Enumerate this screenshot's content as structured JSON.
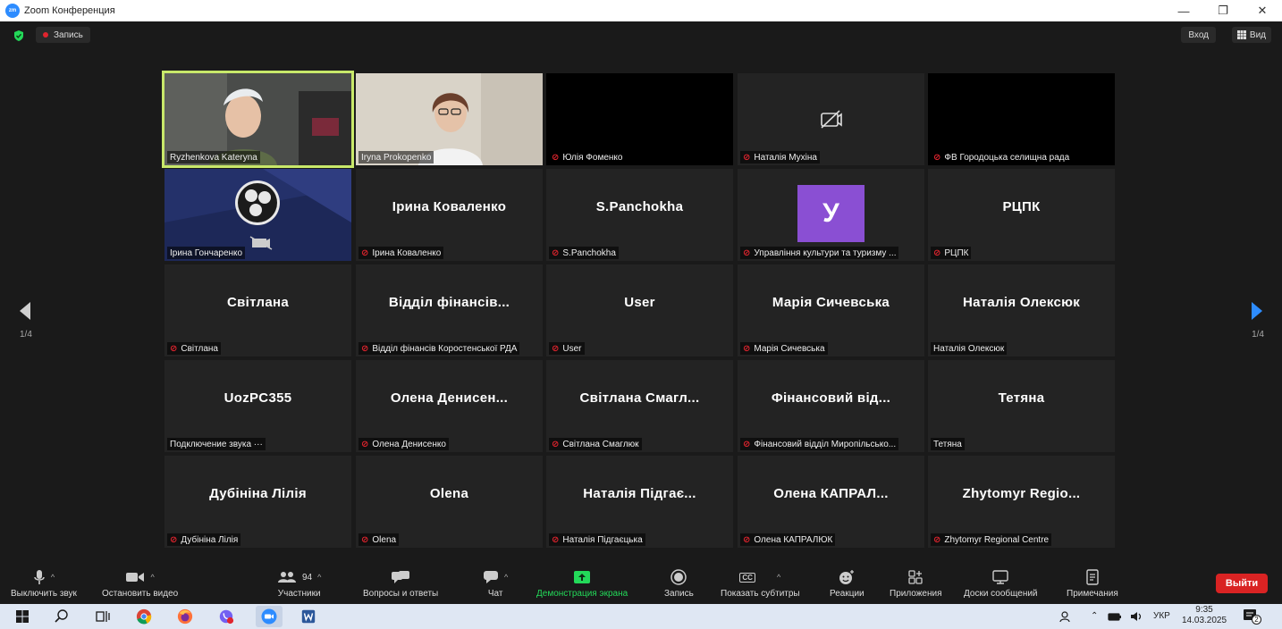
{
  "window": {
    "title": "Zoom Конференция",
    "min": "—",
    "max": "❐",
    "close": "✕"
  },
  "topbar": {
    "record_label": "Запись",
    "login_label": "Вход",
    "view_label": "Вид"
  },
  "pagination": {
    "left": "1/4",
    "right": "1/4"
  },
  "tiles": [
    {
      "name": "Ryzhenkova Kateryna",
      "big": "",
      "muted": false,
      "video": "person1"
    },
    {
      "name": "Iryna Prokopenko",
      "big": "",
      "muted": false,
      "video": "person2"
    },
    {
      "name": "Юлія Фоменко",
      "big": "",
      "muted": true,
      "video": "black"
    },
    {
      "name": "Наталія Мухіна",
      "big": "",
      "muted": true,
      "video": "cam-off"
    },
    {
      "name": "ФВ Городоцька селищна рада",
      "big": "",
      "muted": true,
      "video": "black"
    },
    {
      "name": "Ірина Гончаренко",
      "big": "",
      "muted": false,
      "video": "obs"
    },
    {
      "name": "Ірина Коваленко",
      "big": "Ірина Коваленко",
      "muted": true,
      "video": ""
    },
    {
      "name": "S.Panchokha",
      "big": "S.Panchokha",
      "muted": true,
      "video": ""
    },
    {
      "name": "Управління культури та туризму ...",
      "big": "У",
      "muted": true,
      "video": "avatar"
    },
    {
      "name": "РЦПК",
      "big": "РЦПК",
      "muted": true,
      "video": ""
    },
    {
      "name": "Світлана",
      "big": "Світлана",
      "muted": true,
      "video": ""
    },
    {
      "name": "Відділ фінансів Коростенської РДА",
      "big": "Відділ фінансів...",
      "muted": true,
      "video": ""
    },
    {
      "name": "User",
      "big": "User",
      "muted": true,
      "video": ""
    },
    {
      "name": "Марія Сичевська",
      "big": "Марія Сичевська",
      "muted": true,
      "video": ""
    },
    {
      "name": "Наталія Олексюк",
      "big": "Наталія Олексюк",
      "muted": false,
      "video": ""
    },
    {
      "name": "Подключение звука ···",
      "big": "UozPC355",
      "muted": false,
      "video": ""
    },
    {
      "name": "Олена Денисенко",
      "big": "Олена Денисен...",
      "muted": true,
      "video": ""
    },
    {
      "name": "Світлана Смаглюк",
      "big": "Світлана Смагл...",
      "muted": true,
      "video": ""
    },
    {
      "name": "Фінансовий відділ Миропільсько...",
      "big": "Фінансовий від...",
      "muted": true,
      "video": ""
    },
    {
      "name": "Тетяна",
      "big": "Тетяна",
      "muted": false,
      "video": ""
    },
    {
      "name": "Дубініна Лілія",
      "big": "Дубініна Лілія",
      "muted": true,
      "video": ""
    },
    {
      "name": "Olena",
      "big": "Olena",
      "muted": true,
      "video": ""
    },
    {
      "name": "Наталія Підгаєцька",
      "big": "Наталія Підгає...",
      "muted": true,
      "video": ""
    },
    {
      "name": "Олена КАПРАЛЮК",
      "big": "Олена КАПРАЛ...",
      "muted": true,
      "video": ""
    },
    {
      "name": "Zhytomyr Regional Centre",
      "big": "Zhytomyr Regio...",
      "muted": true,
      "video": ""
    }
  ],
  "toolbar": {
    "mute": "Выключить звук",
    "video": "Остановить видео",
    "participants": "Участники",
    "participants_count": "94",
    "qa": "Вопросы и ответы",
    "chat": "Чат",
    "share": "Демонстрация экрана",
    "record": "Запись",
    "captions": "Показать субтитры",
    "captions_icon": "CC",
    "reactions": "Реакции",
    "apps": "Приложения",
    "boards": "Доски сообщений",
    "notes": "Примечания",
    "leave": "Выйти"
  },
  "colors": {
    "share_green": "#23d959",
    "leave_red": "#d92323",
    "active_border": "#c8e86a",
    "nav_blue": "#2d8cff"
  },
  "taskbar": {
    "lang": "УКР",
    "time": "9:35",
    "date": "14.03.2025",
    "notif_count": "2"
  }
}
